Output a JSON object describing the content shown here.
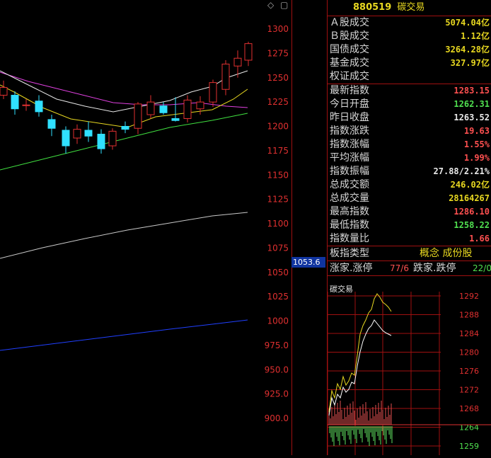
{
  "kline": {
    "price_axis": [
      "1300",
      "1275",
      "1250",
      "1225",
      "1200",
      "1175",
      "1150",
      "1125",
      "1100",
      "1075",
      "1050",
      "1025",
      "1000",
      "975.0",
      "950.0",
      "925.0",
      "900.0"
    ],
    "current_price_tag": "1053.6",
    "top_icons": [
      "diamond-icon",
      "box-icon"
    ],
    "colors": {
      "up": "#e03030",
      "down": "#30e0ff",
      "ma5": "#e8e8e8",
      "ma10": "#e8d820",
      "ma20": "#e040e0",
      "ma30": "#40e040",
      "ma60": "#e8e8e8",
      "ma120": "#2040ff"
    }
  },
  "panel": {
    "code": "880519",
    "name": "碳交易",
    "rows1": [
      {
        "label": "Ａ股成交",
        "value": "5074.04亿",
        "color": "yellow"
      },
      {
        "label": "Ｂ股成交",
        "value": "1.12亿",
        "color": "yellow"
      },
      {
        "label": "国债成交",
        "value": "3264.28亿",
        "color": "yellow"
      },
      {
        "label": "基金成交",
        "value": "327.97亿",
        "color": "yellow"
      },
      {
        "label": "权证成交",
        "value": "",
        "color": "yellow"
      }
    ],
    "rows2": [
      {
        "label": "最新指数",
        "value": "1283.15",
        "color": "red"
      },
      {
        "label": "今日开盘",
        "value": "1262.31",
        "color": "green"
      },
      {
        "label": "昨日收盘",
        "value": "1263.52",
        "color": "white"
      },
      {
        "label": "指数涨跌",
        "value": "19.63",
        "color": "red"
      },
      {
        "label": "指数涨幅",
        "value": "1.55%",
        "color": "red"
      },
      {
        "label": "平均涨幅",
        "value": "1.99%",
        "color": "red"
      },
      {
        "label": "指数振幅",
        "value": "27.88/2.21%",
        "color": "white"
      },
      {
        "label": "总成交额",
        "value": "246.02亿",
        "color": "yellow"
      },
      {
        "label": "总成交量",
        "value": "28164267",
        "color": "yellow"
      },
      {
        "label": "最高指数",
        "value": "1286.10",
        "color": "red"
      },
      {
        "label": "最低指数",
        "value": "1258.22",
        "color": "green"
      },
      {
        "label": "指数量比",
        "value": "1.66",
        "color": "red"
      }
    ],
    "type_label": "板指类型",
    "type_value": "概念 成份股",
    "up_label": "涨家.涨停",
    "up_value": "77/6",
    "down_label": "跌家.跌停",
    "down_value": "22/0"
  },
  "mini": {
    "title": "碳交易",
    "axis": [
      "1292",
      "1288",
      "1284",
      "1280",
      "1276",
      "1272",
      "1268",
      "1264",
      "1259"
    ]
  }
}
